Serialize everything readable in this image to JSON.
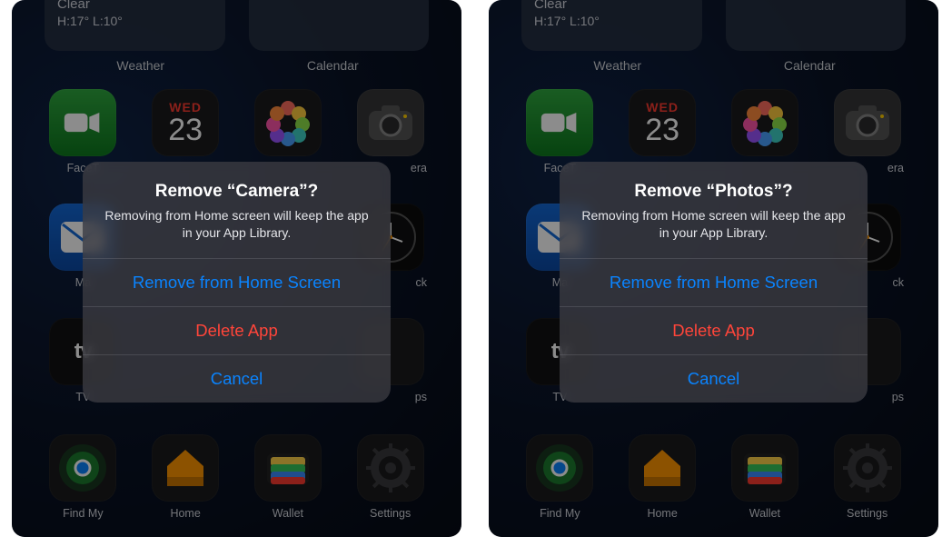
{
  "screens": [
    {
      "weather": {
        "condition": "Clear",
        "hilo": "H:17° L:10°"
      },
      "widget_labels": {
        "weather": "Weather",
        "calendar": "Calendar"
      },
      "cal": {
        "dow": "WED",
        "day": "23"
      },
      "apps_row1": {
        "facetime": "FaceT",
        "camera_partial": "era",
        "mail": "Ma",
        "clock_partial": "ck",
        "tv": "TV",
        "tv_glyph": "tv",
        "tips_partial": "ps"
      },
      "apps_row2": {
        "findmy": "Find My",
        "home": "Home",
        "wallet": "Wallet",
        "settings": "Settings"
      },
      "alert": {
        "title": "Remove “Camera”?",
        "message": "Removing from Home screen will keep the app in your App Library.",
        "remove": "Remove from Home Screen",
        "delete": "Delete App",
        "cancel": "Cancel"
      }
    },
    {
      "weather": {
        "condition": "Clear",
        "hilo": "H:17° L:10°"
      },
      "widget_labels": {
        "weather": "Weather",
        "calendar": "Calendar"
      },
      "cal": {
        "dow": "WED",
        "day": "23"
      },
      "apps_row1": {
        "facetime": "FaceT",
        "camera_partial": "era",
        "mail": "Ma",
        "clock_partial": "ck",
        "tv": "TV",
        "tv_glyph": "tv",
        "tips_partial": "ps"
      },
      "apps_row2": {
        "findmy": "Find My",
        "home": "Home",
        "wallet": "Wallet",
        "settings": "Settings"
      },
      "alert": {
        "title": "Remove “Photos”?",
        "message": "Removing from Home screen will keep the app in your App Library.",
        "remove": "Remove from Home Screen",
        "delete": "Delete App",
        "cancel": "Cancel"
      }
    }
  ]
}
